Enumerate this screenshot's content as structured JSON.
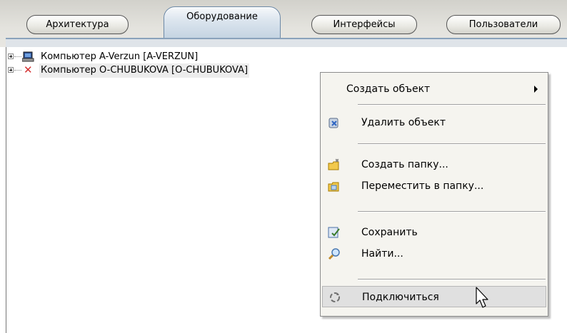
{
  "tabs": [
    {
      "label": "Архитектура",
      "active": false
    },
    {
      "label": "Оборудование",
      "active": true
    },
    {
      "label": "Интерфейсы",
      "active": false
    },
    {
      "label": "Пользователи",
      "active": false
    }
  ],
  "tree": {
    "items": [
      {
        "label": "Компьютер A-Verzun [A-VERZUN]",
        "icon": "computer-icon",
        "status": "connected"
      },
      {
        "label": "Компьютер O-CHUBUKOVA [O-CHUBUKOVA]",
        "icon": "disconnected-x-icon",
        "status": "disconnected"
      }
    ]
  },
  "context_menu": {
    "items": [
      {
        "label": "Создать объект",
        "icon": "",
        "submenu": true
      },
      {
        "label": "Удалить объект",
        "icon": "delete-object-icon"
      },
      {
        "label": "Создать папку...",
        "icon": "new-folder-icon"
      },
      {
        "label": "Переместить в папку...",
        "icon": "move-to-folder-icon"
      },
      {
        "label": "Сохранить",
        "icon": "save-icon"
      },
      {
        "label": "Найти...",
        "icon": "search-icon"
      },
      {
        "label": "Подключиться",
        "icon": "connect-icon",
        "highlighted": true
      }
    ]
  },
  "colors": {
    "active_tab": "#c5d4e2",
    "menu_bg": "#f5f4ef",
    "highlight": "#e0e0e0",
    "disconnected": "#d43030"
  }
}
